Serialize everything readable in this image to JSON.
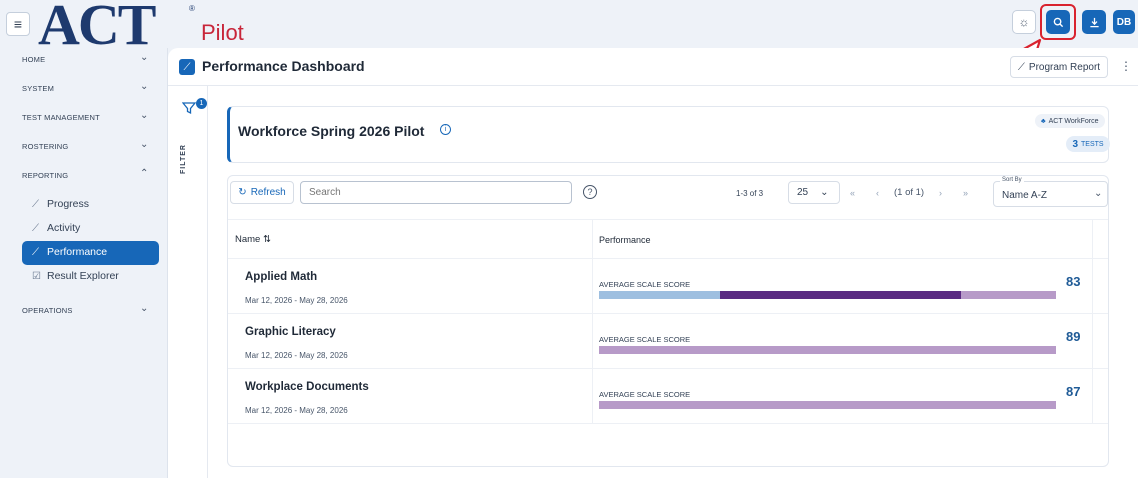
{
  "header": {
    "logo_text": "ACT",
    "logo_reg": "®",
    "product": "Pilot",
    "avatar_initials": "DB"
  },
  "sidebar": {
    "sections": [
      {
        "label": "HOME"
      },
      {
        "label": "SYSTEM"
      },
      {
        "label": "TEST MANAGEMENT"
      },
      {
        "label": "ROSTERING"
      },
      {
        "label": "REPORTING"
      }
    ],
    "reporting_items": [
      {
        "label": "Progress"
      },
      {
        "label": "Activity"
      },
      {
        "label": "Performance"
      },
      {
        "label": "Result Explorer"
      }
    ],
    "operations": {
      "label": "OPERATIONS"
    }
  },
  "page": {
    "title": "Performance Dashboard",
    "program_report_label": "Program Report"
  },
  "filter": {
    "label": "FILTER",
    "badge_count": "1"
  },
  "pilot": {
    "title": "Workforce Spring 2026 Pilot",
    "org_badge": "ACT WorkForce",
    "tests_count": "3",
    "tests_label": "TESTS"
  },
  "toolbar": {
    "refresh_label": "Refresh",
    "search_placeholder": "Search",
    "range_text": "1-3 of 3",
    "page_size": "25",
    "page_text": "(1 of 1)",
    "sort_label": "Sort By",
    "sort_value": "Name A-Z"
  },
  "table": {
    "columns": {
      "name": "Name",
      "performance": "Performance"
    },
    "rows": [
      {
        "name": "Applied Math",
        "dates": "Mar 12, 2026 - May 28, 2026",
        "metric_label": "AVERAGE SCALE SCORE",
        "score": "83",
        "bar_segments": [
          {
            "fraction": 0.265,
            "color": "#9ebfe0"
          },
          {
            "fraction": 0.527,
            "color": "#5a2a82"
          },
          {
            "fraction": 0.208,
            "color": "#b79ac8"
          }
        ]
      },
      {
        "name": "Graphic Literacy",
        "dates": "Mar 12, 2026 - May 28, 2026",
        "metric_label": "AVERAGE SCALE SCORE",
        "score": "89",
        "bar_segments": [
          {
            "fraction": 1,
            "color": "#b79ac8"
          }
        ]
      },
      {
        "name": "Workplace Documents",
        "dates": "Mar 12, 2026 - May 28, 2026",
        "metric_label": "AVERAGE SCALE SCORE",
        "score": "87",
        "bar_segments": [
          {
            "fraction": 1,
            "color": "#b79ac8"
          }
        ]
      }
    ]
  },
  "colors": {
    "brand_blue": "#1767b8",
    "act_navy": "#1e3a6e",
    "pilot_red": "#c8263a",
    "annotation_red": "#d9232f"
  }
}
